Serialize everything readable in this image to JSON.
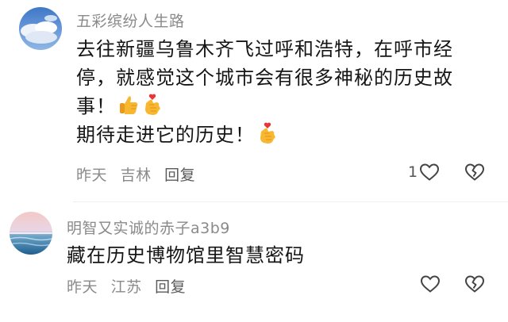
{
  "comments": [
    {
      "username": "五彩缤纷人生路",
      "text_lines": [
        "去往新疆乌鲁木齐飞过呼和浩特，在呼市经",
        "停，就感觉这个城市会有很多神秘的历史故",
        "事！",
        "期待走进它的历史！"
      ],
      "emojis_line3": [
        "thumbs-up-icon",
        "finger-heart-icon"
      ],
      "emojis_line4": [
        "finger-heart-icon"
      ],
      "time": "昨天",
      "location": "吉林",
      "reply_label": "回复",
      "like_count": "1",
      "avatar": "sky-clouds-avatar"
    },
    {
      "username": "明智又实诚的赤子a3b9",
      "text_lines": [
        "藏在历史博物馆里智慧密码"
      ],
      "time": "昨天",
      "location": "江苏",
      "reply_label": "回复",
      "like_count": "",
      "avatar": "sunset-sea-avatar"
    }
  ],
  "colors": {
    "meta_gray": "#8a8a8a",
    "text": "#151515",
    "heart_outline": "#444444",
    "emoji_yellow": "#f7b731",
    "emoji_heart": "#e8343a"
  }
}
